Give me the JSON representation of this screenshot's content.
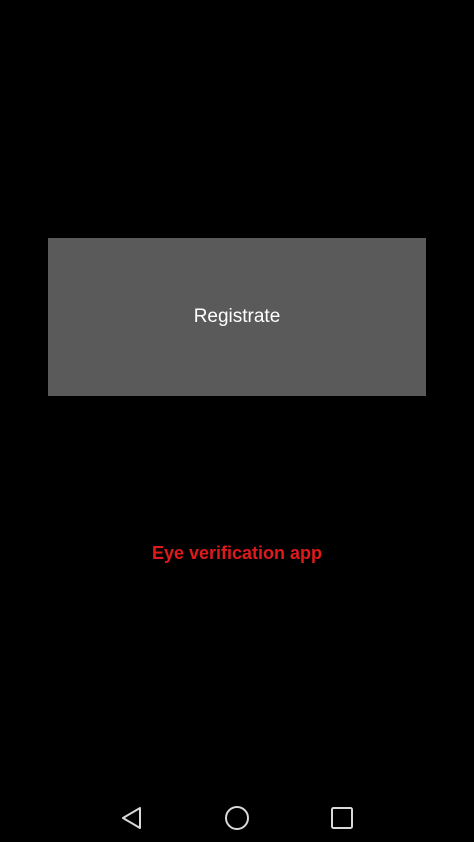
{
  "main": {
    "register_button_label": "Registrate",
    "app_title": "Eye verification app"
  },
  "navigation_bar": {
    "icons": [
      "back-icon",
      "home-icon",
      "recent-apps-icon"
    ]
  },
  "colors": {
    "background": "#000000",
    "button_bg": "#5a5a5a",
    "button_text": "#ffffff",
    "title_text": "#e0191b",
    "nav_icon": "#d9d9d9"
  }
}
